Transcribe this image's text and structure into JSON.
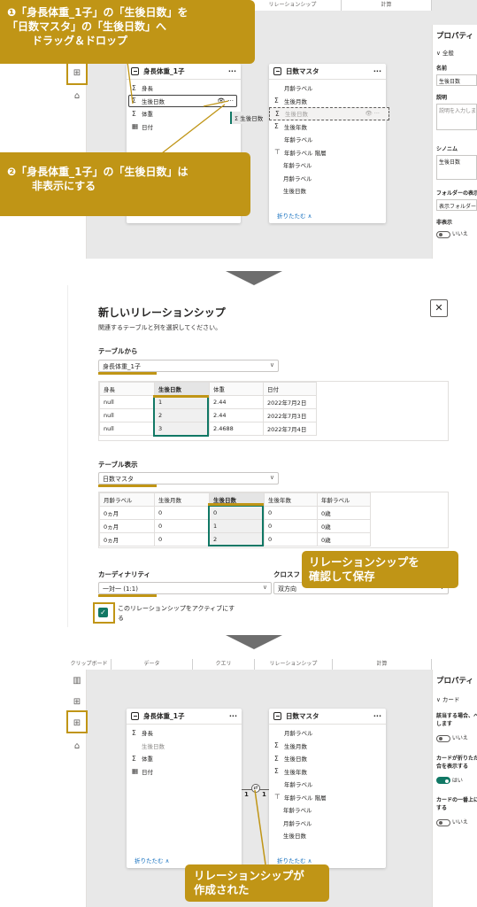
{
  "annotations": {
    "callout1_line1": "❶「身長体重_1子」の「生後日数」を",
    "callout1_line2": "「日数マスタ」の「生後日数」へ",
    "callout1_line3": "ドラッグ＆ドロップ",
    "callout2_line1": "❷「身長体重_1子」の「生後日数」は",
    "callout2_line2": "非表示にする",
    "callout3_line1": "リレーションシップを",
    "callout3_line2": "確認して保存",
    "callout4_line1": "リレーションシップが",
    "callout4_line2": "作成された",
    "colors": {
      "accent": "#c09516",
      "teal": "#117865"
    }
  },
  "top": {
    "ribbon": {
      "relationship": "リレーションシップ",
      "calc": "計算"
    },
    "table1": {
      "title": "身長体重_1子",
      "fields": [
        {
          "sym": "Σ",
          "name": "身長"
        },
        {
          "sym": "Σ",
          "name": "生後日数"
        },
        {
          "sym": "Σ",
          "name": "体重"
        },
        {
          "sym": "▦",
          "name": "日付"
        }
      ]
    },
    "table2": {
      "title": "日数マスタ",
      "fields": [
        {
          "sym": "",
          "name": "月齢ラベル"
        },
        {
          "sym": "Σ",
          "name": "生後月数"
        },
        {
          "sym": "Σ",
          "name": "生後日数"
        },
        {
          "sym": "Σ",
          "name": "生後年数"
        },
        {
          "sym": "",
          "name": "年齢ラベル"
        },
        {
          "sym": "⊤",
          "name": "年齢ラベル 階層"
        },
        {
          "sym": "",
          "name": "年齢ラベル"
        },
        {
          "sym": "",
          "name": "月齢ラベル"
        },
        {
          "sym": "",
          "name": "生後日数"
        }
      ],
      "collapse": "折りたたむ ∧"
    },
    "drag_label": "生後日数",
    "props": {
      "title": "プロパティ",
      "section": "全般",
      "name_label": "名前",
      "name_value": "生後日数",
      "desc_label": "説明",
      "desc_placeholder": "説明を入力しま",
      "syn_label": "シノニム",
      "syn_value": "生後日数",
      "folder_label": "フォルダーの表示",
      "folder_value": "表示フォルダー",
      "hidden_label": "非表示",
      "hidden_value": "いいえ"
    }
  },
  "dialog": {
    "title": "新しいリレーションシップ",
    "subtitle": "関連するテーブルと列を選択してください。",
    "from_label": "テーブルから",
    "from_value": "身長体重_1子",
    "from_headers": [
      "身長",
      "生後日数",
      "体重",
      "日付"
    ],
    "from_rows": [
      [
        "null",
        "1",
        "2.44",
        "2022年7月2日"
      ],
      [
        "null",
        "2",
        "2.44",
        "2022年7月3日"
      ],
      [
        "null",
        "3",
        "2.4688",
        "2022年7月4日"
      ]
    ],
    "to_label": "テーブル表示",
    "to_value": "日数マスタ",
    "to_headers": [
      "月齢ラベル",
      "生後月数",
      "生後日数",
      "生後年数",
      "年齢ラベル"
    ],
    "to_rows": [
      [
        "0ヵ月",
        "0",
        "0",
        "0",
        "0歳"
      ],
      [
        "0ヵ月",
        "0",
        "1",
        "0",
        "0歳"
      ],
      [
        "0ヵ月",
        "0",
        "2",
        "0",
        "0歳"
      ]
    ],
    "card_label": "カーディナリティ",
    "card_value": "一対一 (1:1)",
    "cross_label": "クロスフ",
    "cross_value": "双方向",
    "active_line1": "このリレーションシップをアクティブにす",
    "active_line2": "る",
    "close": "✕"
  },
  "bottom": {
    "ribbon": [
      "クリップボード",
      "データ",
      "クエリ",
      "リレーションシップ",
      "計算"
    ],
    "table1": {
      "title": "身長体重_1子",
      "fields": [
        {
          "sym": "Σ",
          "name": "身長"
        },
        {
          "sym": "",
          "name": "生後日数"
        },
        {
          "sym": "Σ",
          "name": "体重"
        },
        {
          "sym": "▦",
          "name": "日付"
        }
      ],
      "collapse": "折りたたむ ∧"
    },
    "table2": {
      "title": "日数マスタ",
      "fields": [
        {
          "sym": "",
          "name": "月齢ラベル"
        },
        {
          "sym": "Σ",
          "name": "生後月数"
        },
        {
          "sym": "Σ",
          "name": "生後日数"
        },
        {
          "sym": "Σ",
          "name": "生後年数"
        },
        {
          "sym": "",
          "name": "年齢ラベル"
        },
        {
          "sym": "⊤",
          "name": "年齢ラベル 階層"
        },
        {
          "sym": "",
          "name": "年齢ラベル"
        },
        {
          "sym": "",
          "name": "月齢ラベル"
        },
        {
          "sym": "",
          "name": "生後日数"
        }
      ],
      "collapse": "折りたたむ ∧"
    },
    "rel_one_a": "1",
    "rel_one_b": "1",
    "props": {
      "title": "プロパティ",
      "section": "カード",
      "opt1": "該当する場合、ヘッダーを表示します",
      "opt1_val": "いいえ",
      "opt2": "カードが折りたたまれている場合を表示する",
      "opt2_val": "はい",
      "opt3": "カードの一番上にある列を表示する",
      "opt3_val": "いいえ"
    }
  }
}
